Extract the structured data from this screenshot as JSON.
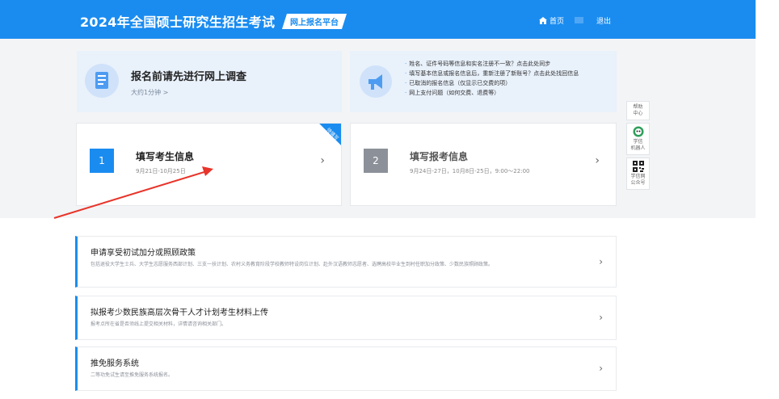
{
  "header": {
    "site_title": "2024年全国硕士研究生招生考试",
    "platform_label": "网上报名平台",
    "home_label": "首页",
    "logout_label": "退出",
    "brand_color": "#1a8cf0"
  },
  "survey": {
    "title": "报名前请先进行网上调查",
    "subtitle": "大约1分钟 >"
  },
  "notices": [
    "姓名、证件号码等信息和实名注册不一致？点击此处同步",
    "填写基本信息或报名信息后，重新注册了新账号？点击此处找回信息",
    "已取消的报名信息（仅显示已交费的项）",
    "网上支付问题（如何交费、退费等）"
  ],
  "steps": [
    {
      "number": "1",
      "title": "填写考生信息",
      "date": "9月21日-10月25日",
      "tag": "待填写",
      "arrow": "›"
    },
    {
      "number": "2",
      "title": "填写报考信息",
      "date": "9月24日-27日，10月8日-25日，9:00～22:00",
      "arrow": "›"
    }
  ],
  "side": {
    "help_line1": "帮助",
    "help_line2": "中心",
    "robot_line1": "学信",
    "robot_line2": "机器人",
    "wechat_line1": "学信网",
    "wechat_line2": "公众号"
  },
  "services": [
    {
      "title": "申请享受初试加分或照顾政策",
      "desc": "包括退役大学生士兵、大学生志愿服务西部计划、三支一扶计划、农村义务教育阶段学校教师特设岗位计划、赴外汉语教师志愿者、选聘高校毕业生到村任职加分政策、少数民族照顾政策。",
      "arrow": "›"
    },
    {
      "title": "拟报考少数民族高层次骨干人才计划考生材料上传",
      "desc": "报考点所在省是否须线上提交相关材料，详情请咨询相关部门。",
      "arrow": "›"
    },
    {
      "title": "推免服务系统",
      "desc": "二等功免试生请至推免服务系统报名。",
      "arrow": "›"
    }
  ]
}
